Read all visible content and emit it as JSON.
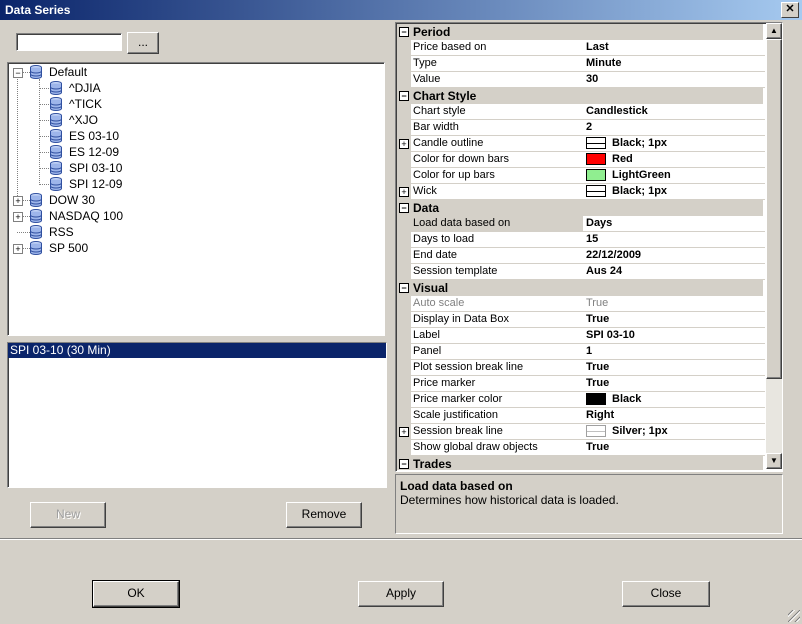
{
  "window": {
    "title": "Data Series"
  },
  "search": {
    "value": "",
    "browse_label": "..."
  },
  "tree": {
    "root": "Default",
    "children": [
      "^DJIA",
      "^TICK",
      "^XJO",
      "ES 03-10",
      "ES 12-09",
      "SPI 03-10",
      "SPI 12-09"
    ],
    "siblings": [
      "DOW 30",
      "NASDAQ 100",
      "RSS",
      "SP 500"
    ]
  },
  "series_list": {
    "items": [
      "SPI 03-10 (30 Min)"
    ]
  },
  "buttons": {
    "new": "New",
    "remove": "Remove",
    "ok": "OK",
    "apply": "Apply",
    "close": "Close"
  },
  "properties": {
    "categories": [
      {
        "name": "Period",
        "rows": [
          {
            "name": "Price based on",
            "value": "Last"
          },
          {
            "name": "Type",
            "value": "Minute"
          },
          {
            "name": "Value",
            "value": "30"
          }
        ]
      },
      {
        "name": "Chart Style",
        "rows": [
          {
            "name": "Chart style",
            "value": "Candlestick"
          },
          {
            "name": "Bar width",
            "value": "2"
          },
          {
            "name": "Candle outline",
            "value": "Black; 1px",
            "swatch": "line",
            "expandable": true
          },
          {
            "name": "Color for down bars",
            "value": "Red",
            "swatch": "#ff0000"
          },
          {
            "name": "Color for up bars",
            "value": "LightGreen",
            "swatch": "#90ee90"
          },
          {
            "name": "Wick",
            "value": "Black; 1px",
            "swatch": "line",
            "expandable": true
          }
        ]
      },
      {
        "name": "Data",
        "rows": [
          {
            "name": "Load data based on",
            "value": "Days",
            "selected": true
          },
          {
            "name": "Days to load",
            "value": "15"
          },
          {
            "name": "End date",
            "value": "22/12/2009"
          },
          {
            "name": "Session template",
            "value": "Aus 24"
          }
        ]
      },
      {
        "name": "Visual",
        "rows": [
          {
            "name": "Auto scale",
            "value": "True",
            "disabled": true
          },
          {
            "name": "Display in Data Box",
            "value": "True"
          },
          {
            "name": "Label",
            "value": "SPI 03-10"
          },
          {
            "name": "Panel",
            "value": "1"
          },
          {
            "name": "Plot session break line",
            "value": "True"
          },
          {
            "name": "Price marker",
            "value": "True"
          },
          {
            "name": "Price marker color",
            "value": "Black",
            "swatch": "#000000"
          },
          {
            "name": "Scale justification",
            "value": "Right"
          },
          {
            "name": "Session break line",
            "value": "Silver; 1px",
            "swatch": "silverline",
            "expandable": true
          },
          {
            "name": "Show global draw objects",
            "value": "True"
          }
        ]
      },
      {
        "name": "Trades",
        "rows": []
      }
    ]
  },
  "description": {
    "title": "Load data based on",
    "text": "Determines how historical data is loaded."
  },
  "colors": {
    "titlebar_start": "#0a246a",
    "titlebar_end": "#a6caf0",
    "selection": "#0a246a",
    "face": "#d4d0c8"
  }
}
